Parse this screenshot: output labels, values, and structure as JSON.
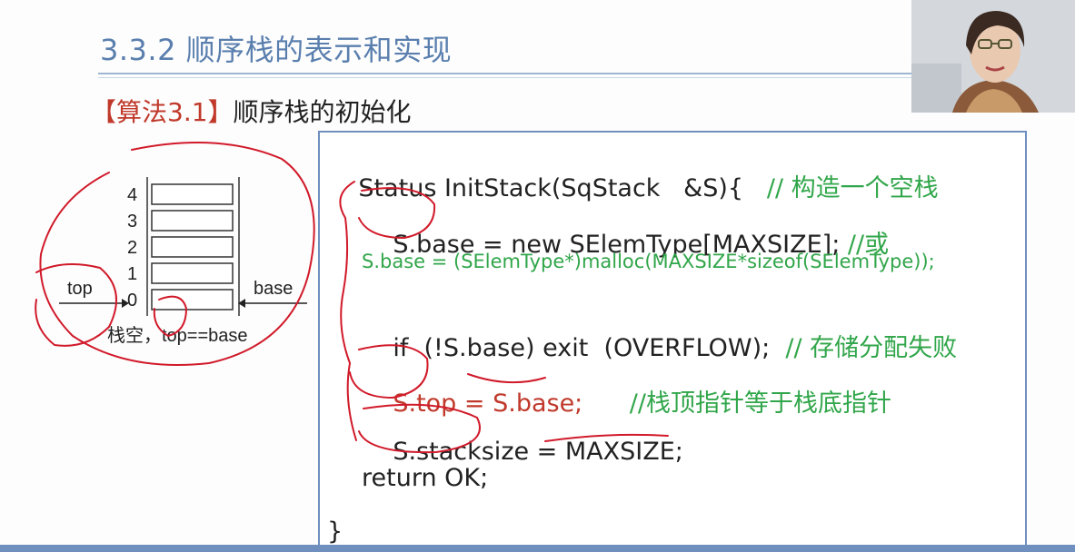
{
  "slide": {
    "title": "3.3.2 顺序栈的表示和实现",
    "heading_tag": "【算法3.1】",
    "heading_text": "顺序栈的初始化"
  },
  "diagram": {
    "indices": [
      "4",
      "3",
      "2",
      "1",
      "0"
    ],
    "top_label": "top",
    "base_label": "base",
    "caption": "栈空，top==base"
  },
  "code": {
    "line1_code": "Status InitStack(SqStack   &S){",
    "line1_comment": "// 构造一个空栈",
    "line2_code": "S.base = new SElemType[MAXSIZE];",
    "line2_comment": "//或",
    "line3": "S.base = (SElemType*)malloc(MAXSIZE*sizeof(SElemType));",
    "line4_code": "if  (!S.base) exit  (OVERFLOW);",
    "line4_comment": "// 存储分配失败",
    "line5_code": "S.top = S.base;",
    "line5_comment": "//栈顶指针等于栈底指针",
    "line6": "S.stacksize = MAXSIZE;",
    "line7": "return OK;",
    "line8": "}"
  },
  "colors": {
    "title": "#5a7fae",
    "accent_red": "#c0392b",
    "comment_green": "#31a64a",
    "box_border": "#6f8fbf"
  }
}
